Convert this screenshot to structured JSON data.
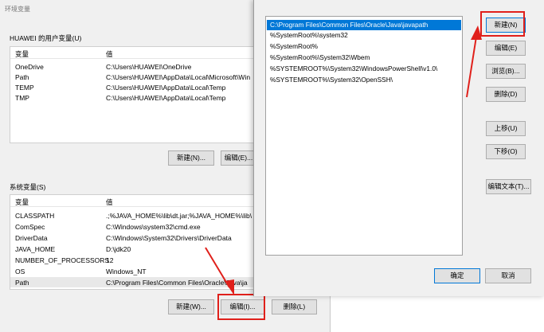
{
  "env_window": {
    "title": "环境变量",
    "user_section": {
      "label": "HUAWEI 的用户变量(U)",
      "columns": [
        "变量",
        "值"
      ],
      "rows": [
        {
          "name": "OneDrive",
          "value": "C:\\Users\\HUAWEI\\OneDrive"
        },
        {
          "name": "Path",
          "value": "C:\\Users\\HUAWEI\\AppData\\Local\\Microsoft\\Win"
        },
        {
          "name": "TEMP",
          "value": "C:\\Users\\HUAWEI\\AppData\\Local\\Temp"
        },
        {
          "name": "TMP",
          "value": "C:\\Users\\HUAWEI\\AppData\\Local\\Temp"
        }
      ],
      "new_label": "新建(N)...",
      "edit_label": "编辑(E)..."
    },
    "system_section": {
      "label": "系统变量(S)",
      "columns": [
        "变量",
        "值"
      ],
      "rows": [
        {
          "name": "CLASSPATH",
          "value": ".;%JAVA_HOME%\\lib\\dt.jar;%JAVA_HOME%\\lib\\"
        },
        {
          "name": "ComSpec",
          "value": "C:\\Windows\\system32\\cmd.exe"
        },
        {
          "name": "DriverData",
          "value": "C:\\Windows\\System32\\Drivers\\DriverData"
        },
        {
          "name": "JAVA_HOME",
          "value": "D:\\jdk20"
        },
        {
          "name": "NUMBER_OF_PROCESSORS",
          "value": "12"
        },
        {
          "name": "OS",
          "value": "Windows_NT"
        },
        {
          "name": "Path",
          "value": "C:\\Program Files\\Common Files\\Oracle\\Java\\ja"
        }
      ],
      "new_label": "新建(W)...",
      "edit_label": "编辑(I)...",
      "delete_label": "删除(L)"
    }
  },
  "edit_dialog": {
    "paths": [
      "C:\\Program Files\\Common Files\\Oracle\\Java\\javapath",
      "%SystemRoot%\\system32",
      "%SystemRoot%",
      "%SystemRoot%\\System32\\Wbem",
      "%SYSTEMROOT%\\System32\\WindowsPowerShell\\v1.0\\",
      "%SYSTEMROOT%\\System32\\OpenSSH\\"
    ],
    "buttons": {
      "new": "新建(N)",
      "edit": "编辑(E)",
      "browse": "浏览(B)...",
      "delete": "删除(D)",
      "move_up": "上移(U)",
      "move_down": "下移(O)",
      "edit_text": "编辑文本(T)...",
      "ok": "确定",
      "cancel": "取消"
    }
  },
  "colors": {
    "selection": "#0078d7",
    "highlight_box": "#e0201b"
  }
}
